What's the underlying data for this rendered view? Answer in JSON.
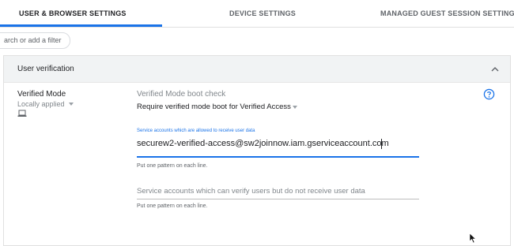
{
  "tabs": [
    {
      "label": "USER & BROWSER SETTINGS",
      "active": true
    },
    {
      "label": "DEVICE SETTINGS",
      "active": false
    },
    {
      "label": "MANAGED GUEST SESSION SETTINGS",
      "active": false
    }
  ],
  "search": {
    "placeholder": "arch or add a filter"
  },
  "section": {
    "title": "User verification",
    "collapse_icon": "chevron-up-icon",
    "setting": {
      "name": "Verified Mode",
      "applied": "Locally applied",
      "device_icon": "laptop-icon"
    },
    "boot_check": {
      "label": "Verified Mode boot check",
      "value": "Require verified mode boot for Verified Access"
    },
    "allowed_accounts": {
      "label": "Service accounts which are allowed to receive user data",
      "value": "securew2-verified-access@sw2joinnow.iam.gserviceaccount.com",
      "helper": "Put one pattern on each line."
    },
    "verify_accounts": {
      "placeholder": "Service accounts which can verify users but do not receive user data",
      "helper": "Put one pattern on each line."
    },
    "help_icon": "help-circle-icon"
  },
  "colors": {
    "accent": "#1a73e8",
    "header_bg": "#f1f3f4",
    "text": "#202124",
    "muted": "#80868b"
  }
}
